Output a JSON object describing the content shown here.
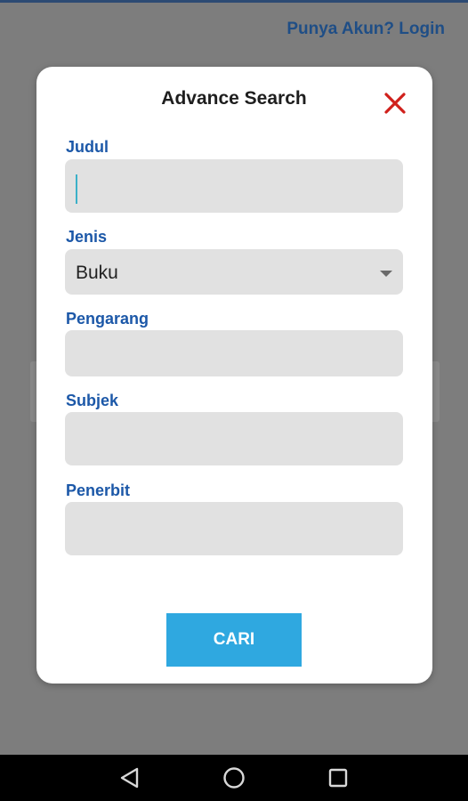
{
  "background": {
    "login_link": "Punya Akun? Login"
  },
  "dialog": {
    "title": "Advance Search",
    "fields": {
      "judul": {
        "label": "Judul",
        "value": ""
      },
      "jenis": {
        "label": "Jenis",
        "selected": "Buku"
      },
      "pengarang": {
        "label": "Pengarang",
        "value": ""
      },
      "subjek": {
        "label": "Subjek",
        "value": ""
      },
      "penerbit": {
        "label": "Penerbit",
        "value": ""
      }
    },
    "search_button": "CARI",
    "close_icon": "close-icon"
  },
  "navbar": {
    "icons": [
      "back-icon",
      "home-icon",
      "recents-icon"
    ]
  },
  "colors": {
    "label_blue": "#1c58a8",
    "button_blue": "#2fa8e0",
    "close_red": "#d0201b",
    "input_bg": "#e1e1e1"
  }
}
